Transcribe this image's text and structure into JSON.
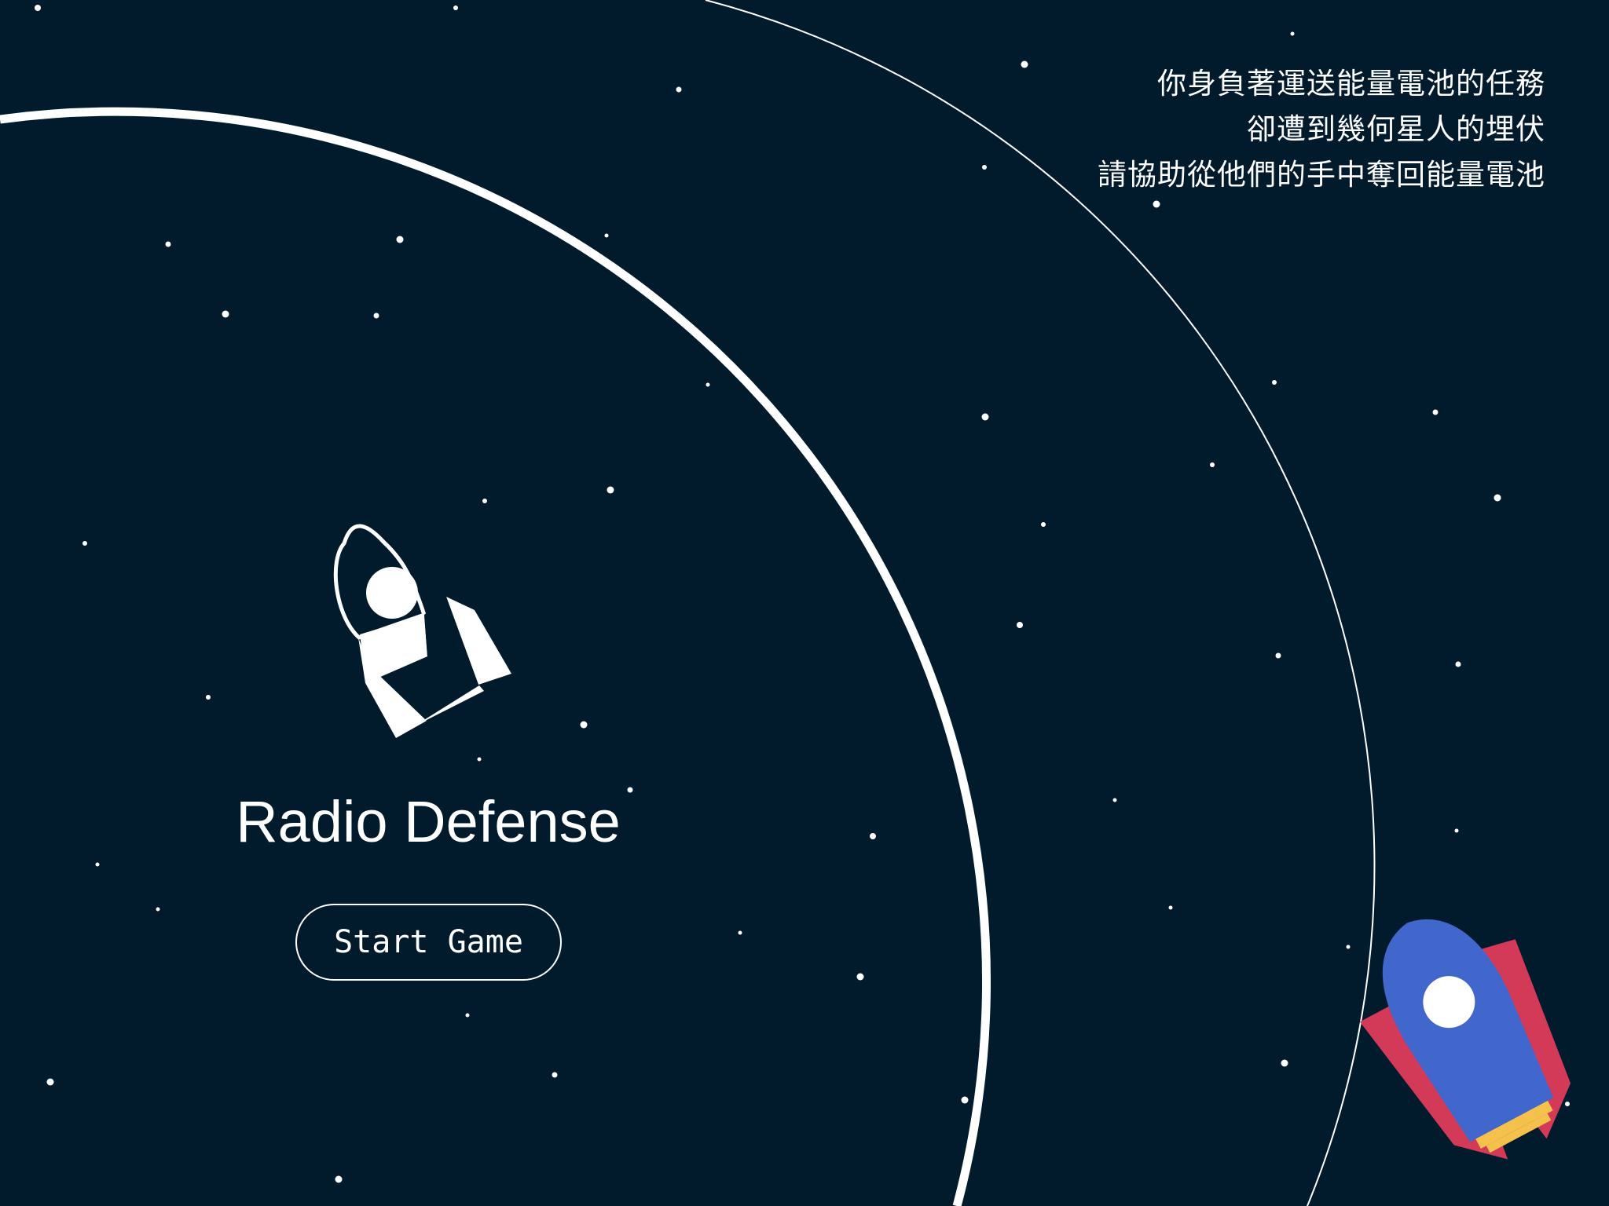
{
  "game": {
    "title": "Radio Defense",
    "start_button_label": "Start Game",
    "story_lines": [
      "你身負著運送能量電池的任務",
      "卻遭到幾何星人的埋伏",
      "請協助從他們的手中奪回能量電池"
    ]
  },
  "colors": {
    "background": "#011b2c",
    "foreground": "#ffffff",
    "player_ship_body": "#4167cc",
    "player_ship_fins": "#d23a58",
    "player_ship_exhaust": "#f5c14d"
  },
  "icons": {
    "logo_icon": "rocket-outline-icon",
    "player_icon": "rocket-icon"
  }
}
